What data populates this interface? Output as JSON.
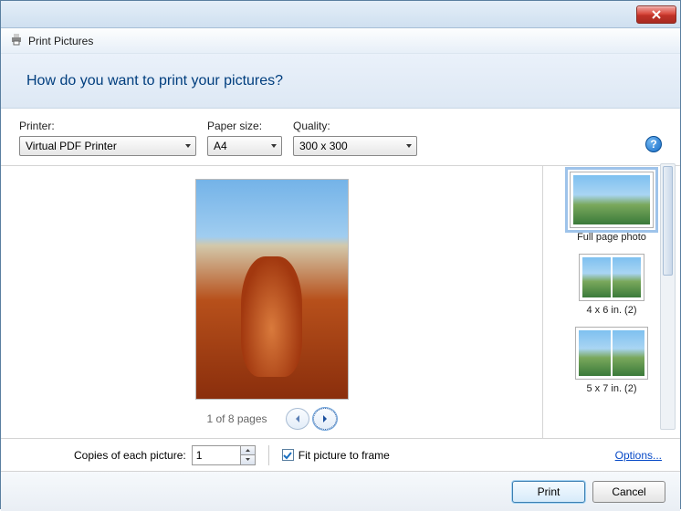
{
  "titlebar": {
    "close_tooltip": "Close"
  },
  "header": {
    "title": "Print Pictures"
  },
  "question": "How do you want to print your pictures?",
  "controls": {
    "printer_label": "Printer:",
    "printer_value": "Virtual PDF Printer",
    "paper_label": "Paper size:",
    "paper_value": "A4",
    "quality_label": "Quality:",
    "quality_value": "300 x 300",
    "help_char": "?"
  },
  "preview": {
    "pager_text": "1 of 8 pages"
  },
  "layouts": [
    {
      "label": "Full page photo",
      "selected": true
    },
    {
      "label": "4 x 6 in. (2)",
      "selected": false
    },
    {
      "label": "5 x 7 in. (2)",
      "selected": false
    }
  ],
  "bottom": {
    "copies_label": "Copies of each picture:",
    "copies_value": "1",
    "fit_label": "Fit picture to frame",
    "fit_checked": true,
    "options_label": "Options..."
  },
  "buttons": {
    "print": "Print",
    "cancel": "Cancel"
  }
}
